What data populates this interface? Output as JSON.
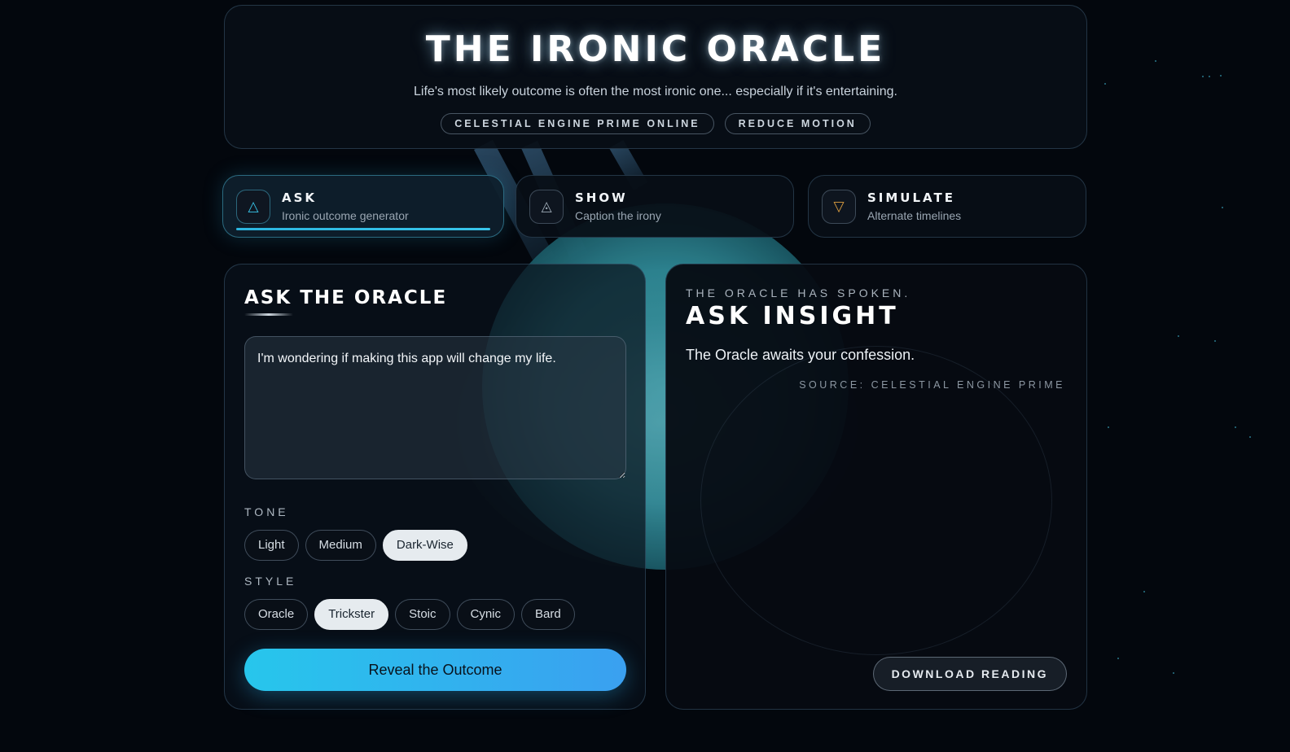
{
  "app": {
    "title": "THE IRONIC ORACLE",
    "subtitle": "Life's most likely outcome is often the most ironic one... especially if it's entertaining.",
    "status_pill": "CELESTIAL ENGINE PRIME ONLINE",
    "motion_pill": "REDUCE MOTION"
  },
  "tabs": [
    {
      "label": "ASK",
      "sub": "Ironic outcome generator",
      "icon": "triangle-up-icon",
      "glyph": "△",
      "color": "#38c5ea",
      "active": true
    },
    {
      "label": "SHOW",
      "sub": "Caption the irony",
      "icon": "triangle-eye-icon",
      "glyph": "◬",
      "color": "#9aa6b2",
      "active": false
    },
    {
      "label": "SIMULATE",
      "sub": "Alternate timelines",
      "icon": "triangle-down-icon",
      "glyph": "▽",
      "color": "#e0a040",
      "active": false
    }
  ],
  "ask_panel": {
    "title": "ASK THE ORACLE",
    "question_value": "I'm wondering if making this app will change my life.",
    "tone_label": "TONE",
    "tones": [
      "Light",
      "Medium",
      "Dark-Wise"
    ],
    "selected_tone": "Dark-Wise",
    "style_label": "STYLE",
    "styles": [
      "Oracle",
      "Trickster",
      "Stoic",
      "Cynic",
      "Bard"
    ],
    "selected_style": "Trickster",
    "reveal_label": "Reveal the Outcome"
  },
  "insight_panel": {
    "overline": "THE ORACLE HAS SPOKEN.",
    "title": "ASK INSIGHT",
    "message": "The Oracle awaits your confession.",
    "source": "SOURCE: CELESTIAL ENGINE PRIME",
    "download_label": "DOWNLOAD READING"
  },
  "colors": {
    "accent": "#38c5ea",
    "button_start": "#27c6ec",
    "button_end": "#3aa0f0",
    "background": "#03070d"
  }
}
